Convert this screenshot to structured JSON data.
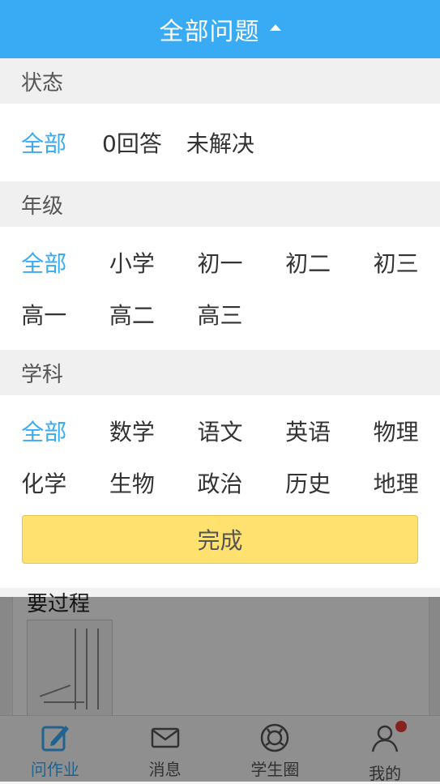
{
  "header": {
    "title": "全部问题"
  },
  "sections": {
    "status": {
      "title": "状态",
      "options": [
        "全部",
        "0回答",
        "未解决"
      ],
      "selected": 0
    },
    "grade": {
      "title": "年级",
      "rows": [
        [
          "全部",
          "小学",
          "初一",
          "初二",
          "初三"
        ],
        [
          "高一",
          "高二",
          "高三"
        ]
      ],
      "selected": "全部"
    },
    "subject": {
      "title": "学科",
      "rows": [
        [
          "全部",
          "数学",
          "语文",
          "英语",
          "物理"
        ],
        [
          "化学",
          "生物",
          "政治",
          "历史",
          "地理"
        ]
      ],
      "selected": "全部"
    }
  },
  "done_label": "完成",
  "background": {
    "question_text": "要过程"
  },
  "tabs": [
    {
      "label": "问作业",
      "icon": "edit-icon"
    },
    {
      "label": "消息",
      "icon": "mail-icon"
    },
    {
      "label": "学生圈",
      "icon": "circle-icon"
    },
    {
      "label": "我的",
      "icon": "user-icon"
    }
  ],
  "colors": {
    "accent": "#39aaf4",
    "done_button": "#ffe16f",
    "badge": "#e53935"
  }
}
